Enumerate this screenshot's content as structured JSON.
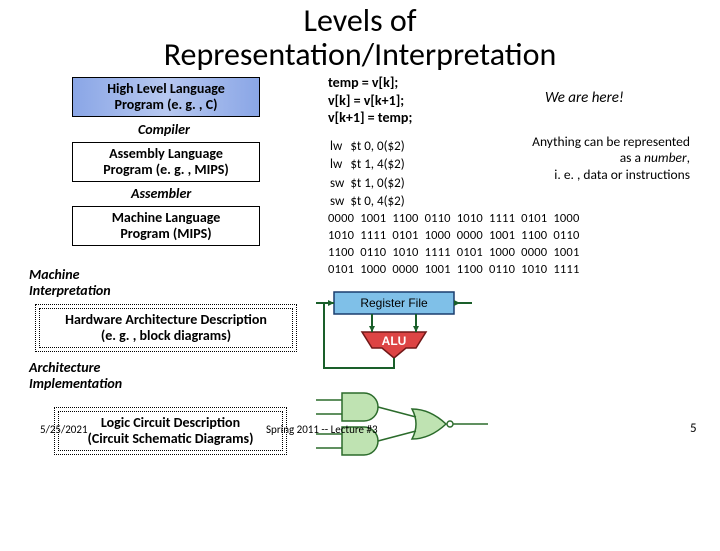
{
  "title_l1": "Levels of",
  "title_l2": "Representation/Interpretation",
  "boxes": {
    "hll": {
      "l1": "High Level Language",
      "l2": "Program (e. g. , C)"
    },
    "asm": {
      "l1": "Assembly  Language",
      "l2": "Program (e. g. , MIPS)"
    },
    "ml": {
      "l1": "Machine  Language",
      "l2": "Program (MIPS)"
    },
    "hw": {
      "l1": "Hardware Architecture Description",
      "l2": "(e. g. , block diagrams)"
    },
    "lc": {
      "l1": "Logic Circuit Description",
      "l2": "(Circuit Schematic Diagrams)"
    }
  },
  "arrows": {
    "compiler": "Compiler",
    "assembler": "Assembler",
    "mi_l1": "Machine",
    "mi_l2": "Interpretation",
    "ai_l1": "Architecture",
    "ai_l2": "Implementation"
  },
  "ccode": {
    "l1": "temp = v[k];",
    "l2": "v[k] = v[k+1];",
    "l3": "v[k+1] = temp;"
  },
  "we_here": "We are here!",
  "asm_rows": [
    {
      "op": "lw",
      "args": "$t 0, 0($2)"
    },
    {
      "op": "lw",
      "args": "$t 1, 4($2)"
    },
    {
      "op": "sw",
      "args": "$t 1, 0($2)"
    },
    {
      "op": "sw",
      "args": "$t 0, 4($2)"
    }
  ],
  "note": {
    "l1": "Anything can be represented",
    "l2": "as a ",
    "l2i": "number",
    "l2x": ",",
    "l3": "i. e. , data or instructions"
  },
  "bin": [
    "0000  1001  1100  0110  1010  1111  0101  1000",
    "1010  1111  0101  1000  0000  1001  1100  0110",
    "1100  0110  1010  1111  0101  1000  0000  1001",
    "0101  1000  0000  1001  1100  0110  1010  1111"
  ],
  "regfile_label": "Register File",
  "alu_label": "ALU",
  "footer": {
    "date": "5/25/2021",
    "center": "Spring 2011 -- Lecture #3",
    "page": "5"
  }
}
